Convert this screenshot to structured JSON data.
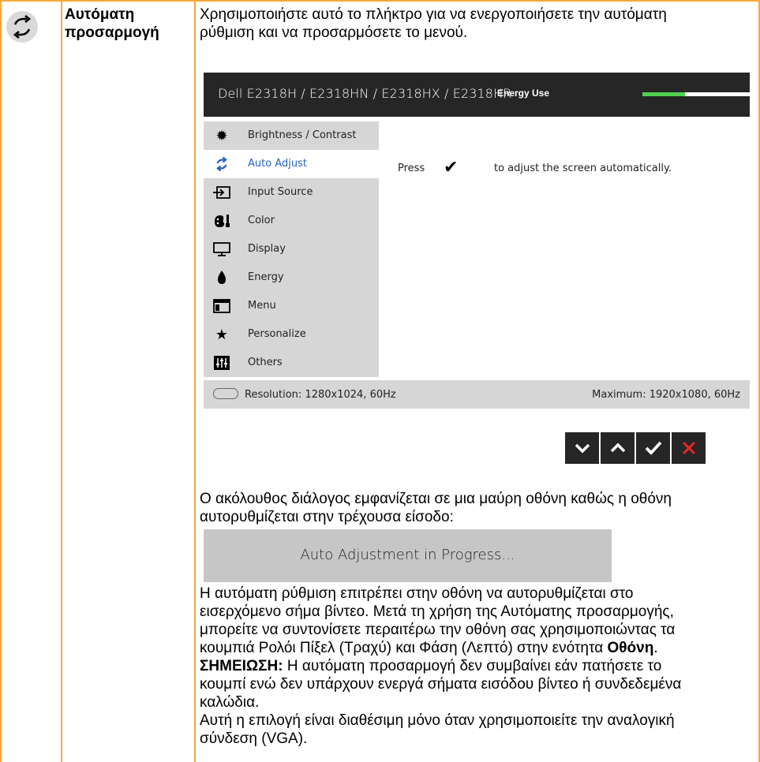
{
  "row": {
    "title_line1": "Αυτόματη",
    "title_line2": "προσαρμογή",
    "intro_line1": "Χρησιμοποιήστε αυτό το πλήκτρο για να ενεργοποιήσετε την αυτόματη",
    "intro_line2": "ρύθμιση και να προσαρμόσετε το μενού."
  },
  "osd": {
    "model": "Dell E2318H / E2318HN / E2318HX / E2318HR",
    "energy_label": "Energy Use",
    "energy_level": 0.4,
    "menu": [
      {
        "label": "Brightness / Contrast",
        "icon": "brightness-icon"
      },
      {
        "label": "Auto Adjust",
        "icon": "auto-adjust-icon",
        "active": true
      },
      {
        "label": "Input Source",
        "icon": "input-source-icon"
      },
      {
        "label": "Color",
        "icon": "color-icon"
      },
      {
        "label": "Display",
        "icon": "display-icon"
      },
      {
        "label": "Energy",
        "icon": "energy-icon"
      },
      {
        "label": "Menu",
        "icon": "menu-icon"
      },
      {
        "label": "Personalize",
        "icon": "star-icon"
      },
      {
        "label": "Others",
        "icon": "others-icon"
      }
    ],
    "press_word": "Press",
    "press_rest": "to adjust the screen automatically.",
    "resolution": "Resolution: 1280x1024, 60Hz",
    "maximum": "Maximum: 1920x1080, 60Hz",
    "buttons": [
      "down-icon",
      "up-icon",
      "check-icon",
      "exit-icon"
    ]
  },
  "dialog_intro_line1": "Ο ακόλουθος διάλογος εμφανίζεται σε μια μαύρη οθόνη καθώς η οθόνη",
  "dialog_intro_line2": "αυτορυθμίζεται στην τρέχουσα είσοδο:",
  "progress_text": "Auto Adjustment in Progress...",
  "body": {
    "p1_line1": "Η αυτόματη ρύθμιση επιτρέπει στην οθόνη να αυτορυθμίζεται στο",
    "p1_line2": "εισερχόμενο σήμα βίντεο. Μετά τη χρήση της Αυτόματης προσαρμογής,",
    "p1_line3": "μπορείτε να συντονίσετε περαιτέρω την οθόνη σας χρησιμοποιώντας τα",
    "p1_line4_a": "κουμπιά Ρολόι Πίξελ (Τραχύ) και Φάση (Λεπτό) στην ενότητα ",
    "p1_line4_bold": "Οθόνη",
    "p1_line4_end": ".",
    "note_label": "ΣΗΜΕΙΩΣΗ:",
    "note_line1": " Η αυτόματη προσαρμογή δεν συμβαίνει εάν πατήσετε το",
    "note_line2": "κουμπί ενώ δεν υπάρχουν ενεργά σήματα εισόδου βίντεο ή συνδεδεμένα",
    "note_line3": "καλώδια.",
    "vga_line1": "Αυτή η επιλογή είναι διαθέσιμη μόνο όταν χρησιμοποιείτε την αναλογική",
    "vga_line2": "σύνδεση (VGA)."
  }
}
